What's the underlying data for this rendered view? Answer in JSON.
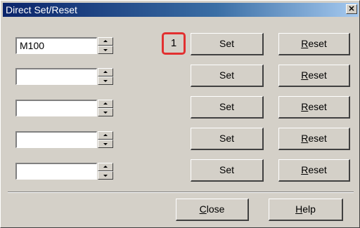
{
  "window": {
    "title": "Direct Set/Reset",
    "close_glyph": "✕"
  },
  "rows": [
    {
      "value": "M100",
      "set_label": "Set",
      "reset_prefix": "",
      "reset_mnemonic": "R",
      "reset_rest": "eset"
    },
    {
      "value": "",
      "set_label": "Set",
      "reset_prefix": "",
      "reset_mnemonic": "R",
      "reset_rest": "eset"
    },
    {
      "value": "",
      "set_label": "Set",
      "reset_prefix": "",
      "reset_mnemonic": "R",
      "reset_rest": "eset"
    },
    {
      "value": "",
      "set_label": "Set",
      "reset_prefix": "",
      "reset_mnemonic": "R",
      "reset_rest": "eset"
    },
    {
      "value": "",
      "set_label": "Set",
      "reset_prefix": "",
      "reset_mnemonic": "R",
      "reset_rest": "eset"
    }
  ],
  "callout": {
    "number": "1",
    "color": "#e23030"
  },
  "footer": {
    "close": {
      "mnemonic": "C",
      "rest": "lose"
    },
    "help": {
      "mnemonic": "H",
      "rest": "elp"
    }
  }
}
